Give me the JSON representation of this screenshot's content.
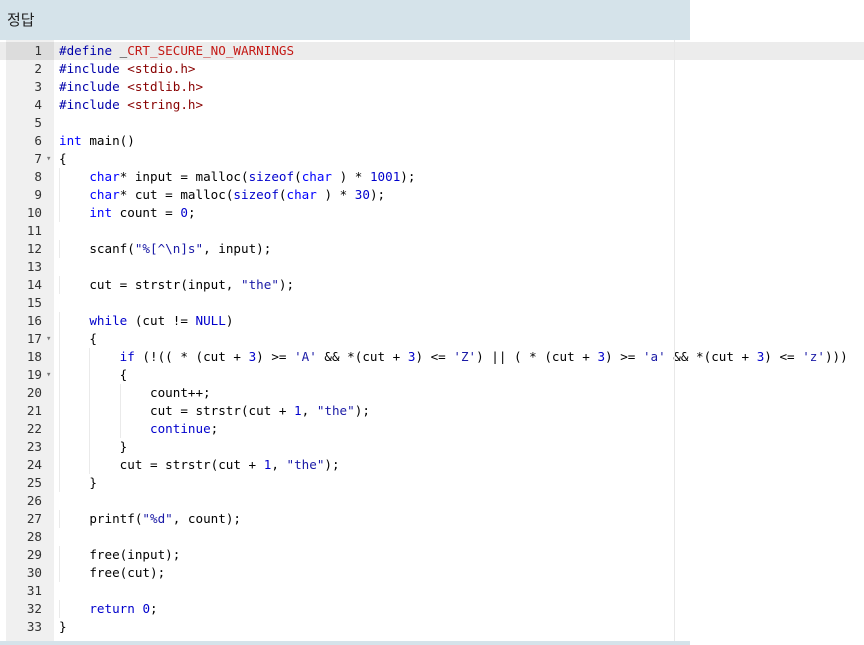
{
  "header": {
    "title": "정답"
  },
  "editor": {
    "active_line": 1,
    "lines": [
      {
        "n": "1",
        "fold": false,
        "tokens": [
          [
            "pp",
            "#define"
          ],
          [
            "",
            "_"
          ],
          [
            "ppv",
            "CRT_SECURE_NO_WARNINGS"
          ]
        ]
      },
      {
        "n": "2",
        "fold": false,
        "tokens": [
          [
            "pp",
            "#include"
          ],
          [
            "",
            ""
          ],
          [
            "inc",
            "<stdio.h>"
          ]
        ]
      },
      {
        "n": "3",
        "fold": false,
        "tokens": [
          [
            "pp",
            "#include"
          ],
          [
            "",
            ""
          ],
          [
            "inc",
            "<stdlib.h>"
          ]
        ]
      },
      {
        "n": "4",
        "fold": false,
        "tokens": [
          [
            "pp",
            "#include"
          ],
          [
            "",
            ""
          ],
          [
            "inc",
            "<string.h>"
          ]
        ]
      },
      {
        "n": "5",
        "fold": false,
        "tokens": []
      },
      {
        "n": "6",
        "fold": false,
        "tokens": [
          [
            "type",
            "int"
          ],
          [
            "",
            " main()"
          ]
        ]
      },
      {
        "n": "7",
        "fold": true,
        "tokens": [
          [
            "",
            "{"
          ]
        ]
      },
      {
        "n": "8",
        "fold": false,
        "tokens": [
          [
            "",
            "    "
          ],
          [
            "type",
            "char"
          ],
          [
            "",
            "* input = malloc("
          ],
          [
            "kw",
            "sizeof"
          ],
          [
            "",
            "("
          ],
          [
            "type",
            "char"
          ],
          [
            "",
            " ) * "
          ],
          [
            "num",
            "1001"
          ],
          [
            "",
            ");"
          ]
        ]
      },
      {
        "n": "9",
        "fold": false,
        "tokens": [
          [
            "",
            "    "
          ],
          [
            "type",
            "char"
          ],
          [
            "",
            "* cut = malloc("
          ],
          [
            "kw",
            "sizeof"
          ],
          [
            "",
            "("
          ],
          [
            "type",
            "char"
          ],
          [
            "",
            " ) * "
          ],
          [
            "num",
            "30"
          ],
          [
            "",
            ");"
          ]
        ]
      },
      {
        "n": "10",
        "fold": false,
        "tokens": [
          [
            "",
            "    "
          ],
          [
            "type",
            "int"
          ],
          [
            "",
            " count = "
          ],
          [
            "num",
            "0"
          ],
          [
            "",
            ";"
          ]
        ]
      },
      {
        "n": "11",
        "fold": false,
        "tokens": []
      },
      {
        "n": "12",
        "fold": false,
        "tokens": [
          [
            "",
            "    scanf("
          ],
          [
            "str",
            "\"%[^\\n]s\""
          ],
          [
            "",
            ", input);"
          ]
        ]
      },
      {
        "n": "13",
        "fold": false,
        "tokens": []
      },
      {
        "n": "14",
        "fold": false,
        "tokens": [
          [
            "",
            "    cut = strstr(input, "
          ],
          [
            "str",
            "\"the\""
          ],
          [
            "",
            ");"
          ]
        ]
      },
      {
        "n": "15",
        "fold": false,
        "tokens": []
      },
      {
        "n": "16",
        "fold": false,
        "tokens": [
          [
            "",
            "    "
          ],
          [
            "kw",
            "while"
          ],
          [
            "",
            " (cut != "
          ],
          [
            "kw",
            "NULL"
          ],
          [
            "",
            ")"
          ]
        ]
      },
      {
        "n": "17",
        "fold": true,
        "tokens": [
          [
            "",
            "    {"
          ]
        ]
      },
      {
        "n": "18",
        "fold": false,
        "tokens": [
          [
            "",
            "        "
          ],
          [
            "kw",
            "if"
          ],
          [
            "",
            " (!(( * (cut + "
          ],
          [
            "num",
            "3"
          ],
          [
            "",
            ") >= "
          ],
          [
            "str",
            "'A'"
          ],
          [
            "",
            " && *(cut + "
          ],
          [
            "num",
            "3"
          ],
          [
            "",
            ") <= "
          ],
          [
            "str",
            "'Z'"
          ],
          [
            "",
            ") || ( * (cut + "
          ],
          [
            "num",
            "3"
          ],
          [
            "",
            ") >= "
          ],
          [
            "str",
            "'a'"
          ],
          [
            "",
            " && *(cut + "
          ],
          [
            "num",
            "3"
          ],
          [
            "",
            ") <= "
          ],
          [
            "str",
            "'z'"
          ],
          [
            "",
            ")))"
          ]
        ]
      },
      {
        "n": "19",
        "fold": true,
        "tokens": [
          [
            "",
            "        {"
          ]
        ]
      },
      {
        "n": "20",
        "fold": false,
        "tokens": [
          [
            "",
            "            count++;"
          ]
        ]
      },
      {
        "n": "21",
        "fold": false,
        "tokens": [
          [
            "",
            "            cut = strstr(cut + "
          ],
          [
            "num",
            "1"
          ],
          [
            "",
            ", "
          ],
          [
            "str",
            "\"the\""
          ],
          [
            "",
            ");"
          ]
        ]
      },
      {
        "n": "22",
        "fold": false,
        "tokens": [
          [
            "",
            "            "
          ],
          [
            "kw",
            "continue"
          ],
          [
            "",
            ";"
          ]
        ]
      },
      {
        "n": "23",
        "fold": false,
        "tokens": [
          [
            "",
            "        }"
          ]
        ]
      },
      {
        "n": "24",
        "fold": false,
        "tokens": [
          [
            "",
            "        cut = strstr(cut + "
          ],
          [
            "num",
            "1"
          ],
          [
            "",
            ", "
          ],
          [
            "str",
            "\"the\""
          ],
          [
            "",
            ");"
          ]
        ]
      },
      {
        "n": "25",
        "fold": false,
        "tokens": [
          [
            "",
            "    }"
          ]
        ]
      },
      {
        "n": "26",
        "fold": false,
        "tokens": []
      },
      {
        "n": "27",
        "fold": false,
        "tokens": [
          [
            "",
            "    printf("
          ],
          [
            "str",
            "\"%d\""
          ],
          [
            "",
            ", count);"
          ]
        ]
      },
      {
        "n": "28",
        "fold": false,
        "tokens": []
      },
      {
        "n": "29",
        "fold": false,
        "tokens": [
          [
            "",
            "    free(input);"
          ]
        ]
      },
      {
        "n": "30",
        "fold": false,
        "tokens": [
          [
            "",
            "    free(cut);"
          ]
        ]
      },
      {
        "n": "31",
        "fold": false,
        "tokens": []
      },
      {
        "n": "32",
        "fold": false,
        "tokens": [
          [
            "",
            "    "
          ],
          [
            "kw",
            "return"
          ],
          [
            "",
            " "
          ],
          [
            "num",
            "0"
          ],
          [
            "",
            ";"
          ]
        ]
      },
      {
        "n": "33",
        "fold": false,
        "tokens": [
          [
            "",
            "}"
          ]
        ]
      }
    ]
  }
}
